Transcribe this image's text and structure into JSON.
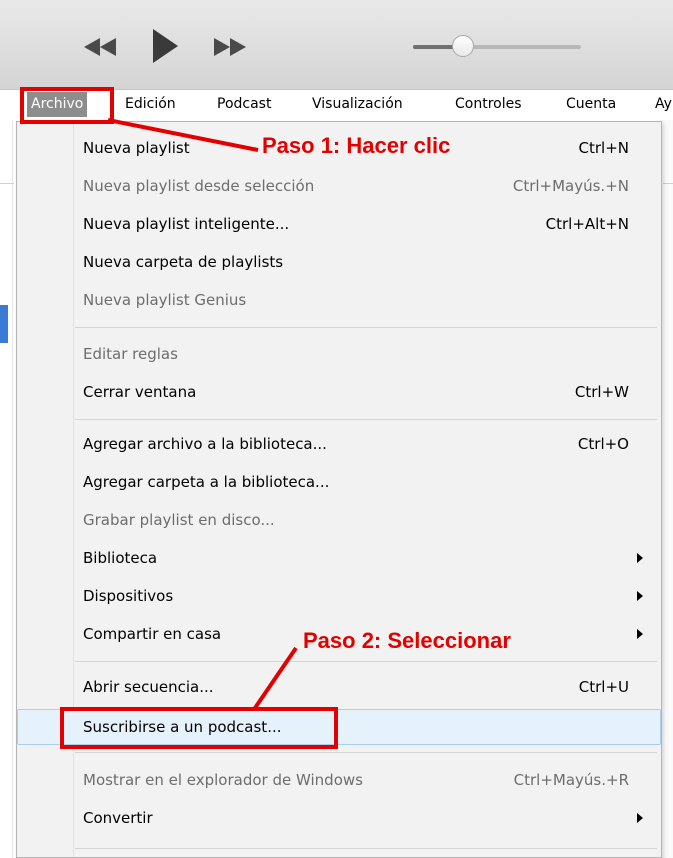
{
  "toolbar": {
    "rewind_icon": "rewind-icon",
    "play_icon": "play-icon",
    "forward_icon": "fast-forward-icon",
    "volume_level": 0.25
  },
  "menubar": [
    {
      "label": "Archivo",
      "active": true
    },
    {
      "label": "Edición"
    },
    {
      "label": "Podcast"
    },
    {
      "label": "Visualización"
    },
    {
      "label": "Controles"
    },
    {
      "label": "Cuenta"
    },
    {
      "label": "Ay"
    }
  ],
  "menu": {
    "items": [
      {
        "label": "Nueva playlist",
        "shortcut": "Ctrl+N",
        "enabled": true
      },
      {
        "label": "Nueva playlist desde selección",
        "shortcut": "Ctrl+Mayús.+N",
        "enabled": false
      },
      {
        "label": "Nueva playlist inteligente...",
        "shortcut": "Ctrl+Alt+N",
        "enabled": true
      },
      {
        "label": "Nueva carpeta de playlists",
        "shortcut": "",
        "enabled": true
      },
      {
        "label": "Nueva playlist Genius",
        "shortcut": "",
        "enabled": false
      },
      {
        "label": "Editar reglas",
        "shortcut": "",
        "enabled": false
      },
      {
        "label": "Cerrar ventana",
        "shortcut": "Ctrl+W",
        "enabled": true
      },
      {
        "label": "Agregar archivo a la biblioteca...",
        "shortcut": "Ctrl+O",
        "enabled": true
      },
      {
        "label": "Agregar carpeta a la biblioteca...",
        "shortcut": "",
        "enabled": true
      },
      {
        "label": "Grabar playlist en disco...",
        "shortcut": "",
        "enabled": false
      },
      {
        "label": "Biblioteca",
        "shortcut": "",
        "enabled": true,
        "submenu": true
      },
      {
        "label": "Dispositivos",
        "shortcut": "",
        "enabled": true,
        "submenu": true
      },
      {
        "label": "Compartir en casa",
        "shortcut": "",
        "enabled": true,
        "submenu": true
      },
      {
        "label": "Abrir secuencia...",
        "shortcut": "Ctrl+U",
        "enabled": true
      },
      {
        "label": "Suscribirse a un podcast...",
        "shortcut": "",
        "enabled": true,
        "highlighted": true
      },
      {
        "label": "Mostrar en el explorador de Windows",
        "shortcut": "Ctrl+Mayús.+R",
        "enabled": false
      },
      {
        "label": "Convertir",
        "shortcut": "",
        "enabled": true,
        "submenu": true
      }
    ]
  },
  "annotations": {
    "step1": "Paso 1: Hacer clic",
    "step2": "Paso 2: Seleccionar",
    "color": "#e30000"
  },
  "colors": {
    "menu_bg": "#f2f2f2",
    "hover_bg": "#e5f1fb",
    "hover_border": "#a9cfee",
    "active_menubar": "#8d8d8d"
  }
}
